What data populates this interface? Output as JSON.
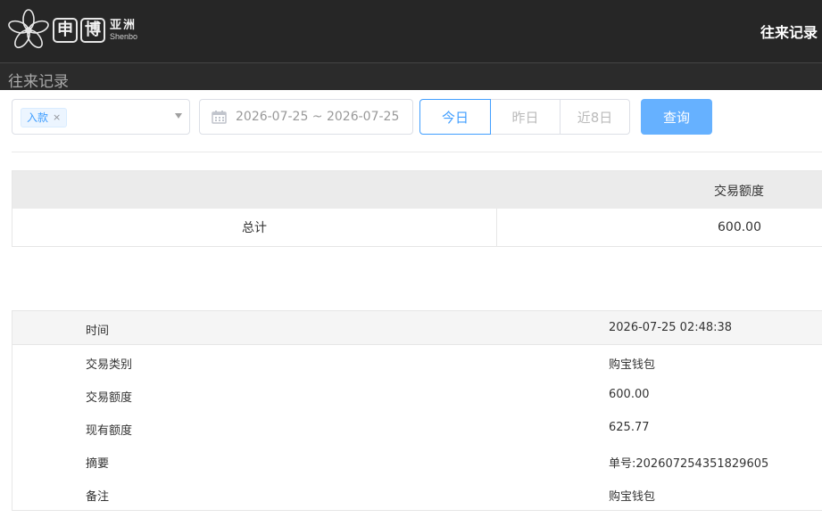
{
  "header": {
    "logo_char_1": "申",
    "logo_char_2": "博",
    "logo_asia": "亚洲",
    "logo_en": "Shenbo",
    "title": "往来记录"
  },
  "subbar": {
    "title": "往来记录"
  },
  "filters": {
    "type_tag": "入款",
    "tag_close": "×",
    "date_range": "2026-07-25 ~ 2026-07-25",
    "quick_buttons": [
      "今日",
      "昨日",
      "近8日"
    ],
    "query_label": "查询"
  },
  "summary": {
    "header": "交易额度",
    "total_label": "总计",
    "total_value": "600.00"
  },
  "detail": {
    "rows": [
      {
        "label": "时间",
        "value": "2026-07-25 02:48:38"
      },
      {
        "label": "交易类别",
        "value": "购宝钱包"
      },
      {
        "label": "交易额度",
        "value": "600.00"
      },
      {
        "label": "现有额度",
        "value": "625.77"
      },
      {
        "label": "摘要",
        "value": "单号:202607254351829605"
      },
      {
        "label": "备注",
        "value": "购宝钱包"
      }
    ]
  },
  "colors": {
    "header_bg": "#262626",
    "accent": "#409eff",
    "query_bg": "#66b1ff",
    "table_head_bg": "#ebebeb"
  },
  "icons": [
    "flower-logo-icon",
    "calendar-icon",
    "chevron-down-icon",
    "close-icon"
  ]
}
